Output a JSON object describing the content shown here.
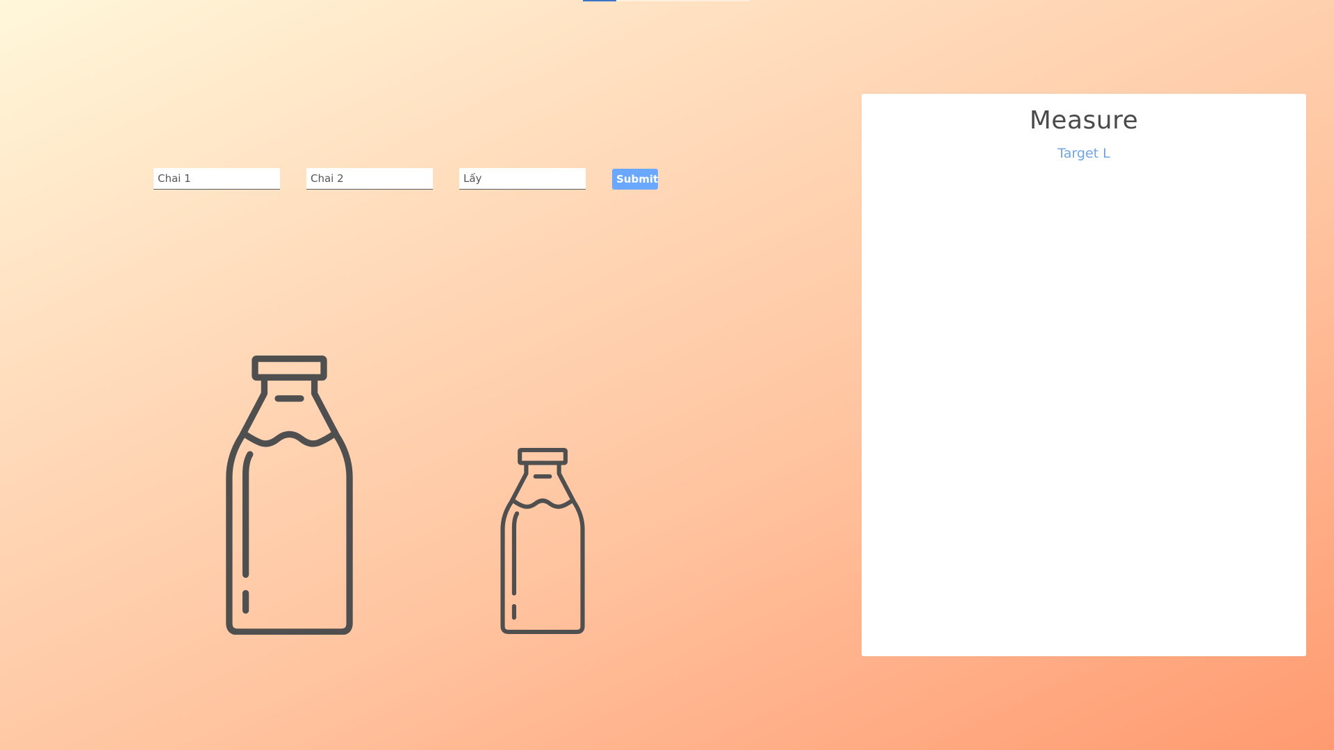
{
  "inputs": {
    "bottle1_placeholder": "Chai 1",
    "bottle2_placeholder": "Chai 2",
    "take_placeholder": "Lấy"
  },
  "submit_label": "Submit",
  "panel": {
    "title": "Measure",
    "subtitle": "Target L"
  },
  "icons": {
    "bottle_large": "milk-bottle-icon",
    "bottle_small": "milk-bottle-icon"
  },
  "colors": {
    "accent": "#6aa7ff",
    "icon_stroke": "#4f4f4f",
    "subtitle": "#6ea4ea"
  }
}
